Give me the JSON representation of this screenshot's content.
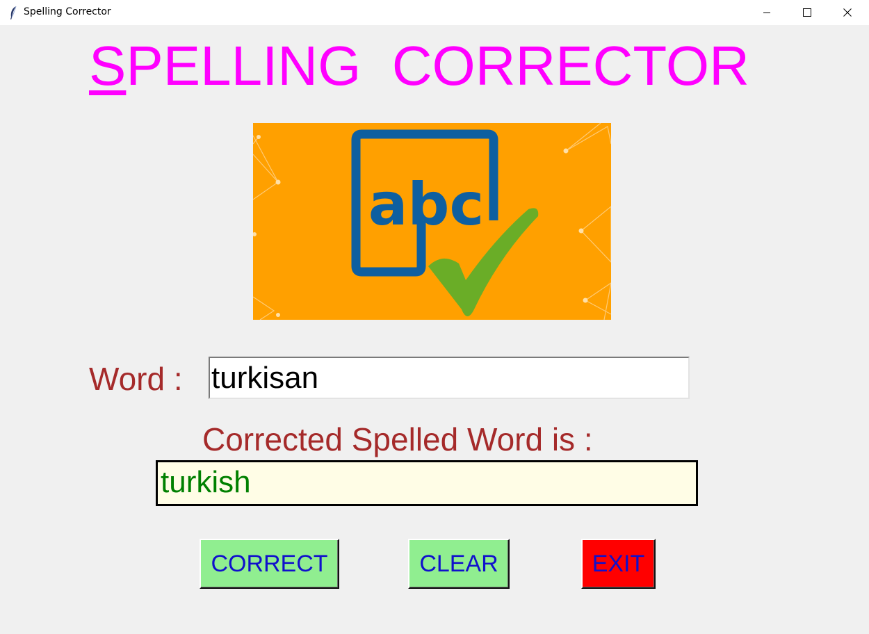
{
  "window": {
    "title": "Spelling Corrector"
  },
  "heading": {
    "first_letter": "S",
    "rest": "PELLING  CORRECTOR",
    "color": "#ff00ff"
  },
  "banner": {
    "text": "abc",
    "background": "#ffa000",
    "frame_color": "#0e5fa0",
    "check_color": "#6aad27"
  },
  "form": {
    "word_label": "Word :",
    "word_value": "turkisan",
    "result_label": "Corrected Spelled Word is :",
    "result_value": "turkish"
  },
  "buttons": {
    "correct": {
      "label": "CORRECT",
      "color": "#90ee90"
    },
    "clear": {
      "label": "CLEAR",
      "color": "#90ee90"
    },
    "exit": {
      "label": "EXIT",
      "color": "#ff0000"
    }
  }
}
